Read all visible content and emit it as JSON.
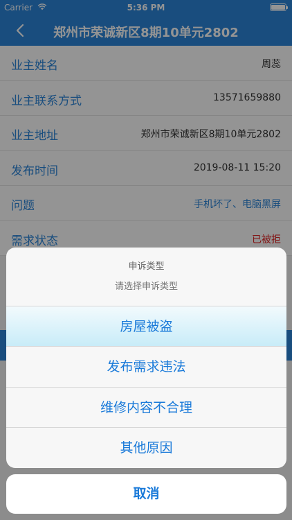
{
  "status_bar": {
    "carrier": "Carrier",
    "time": "5:36 PM"
  },
  "nav": {
    "title": "郑州市荣诚新区8期10单元2802"
  },
  "details": [
    {
      "label": "业主姓名",
      "value": "周蕊",
      "color": "default"
    },
    {
      "label": "业主联系方式",
      "value": "13571659880",
      "color": "default"
    },
    {
      "label": "业主地址",
      "value": "郑州市荣诚新区8期10单元2802",
      "color": "default"
    },
    {
      "label": "发布时间",
      "value": "2019-08-11 15:20",
      "color": "default"
    },
    {
      "label": "问题",
      "value": "手机坏了、电脑黑屏",
      "color": "blue"
    },
    {
      "label": "需求状态",
      "value": "已被拒",
      "color": "red"
    }
  ],
  "action_sheet": {
    "title": "申诉类型",
    "message": "请选择申诉类型",
    "options": [
      "房屋被盗",
      "发布需求违法",
      "维修内容不合理",
      "其他原因"
    ],
    "cancel_label": "取消"
  },
  "colors": {
    "primary": "#2b86d9",
    "action_text": "#1a7ad9",
    "rejected": "#e02020"
  }
}
